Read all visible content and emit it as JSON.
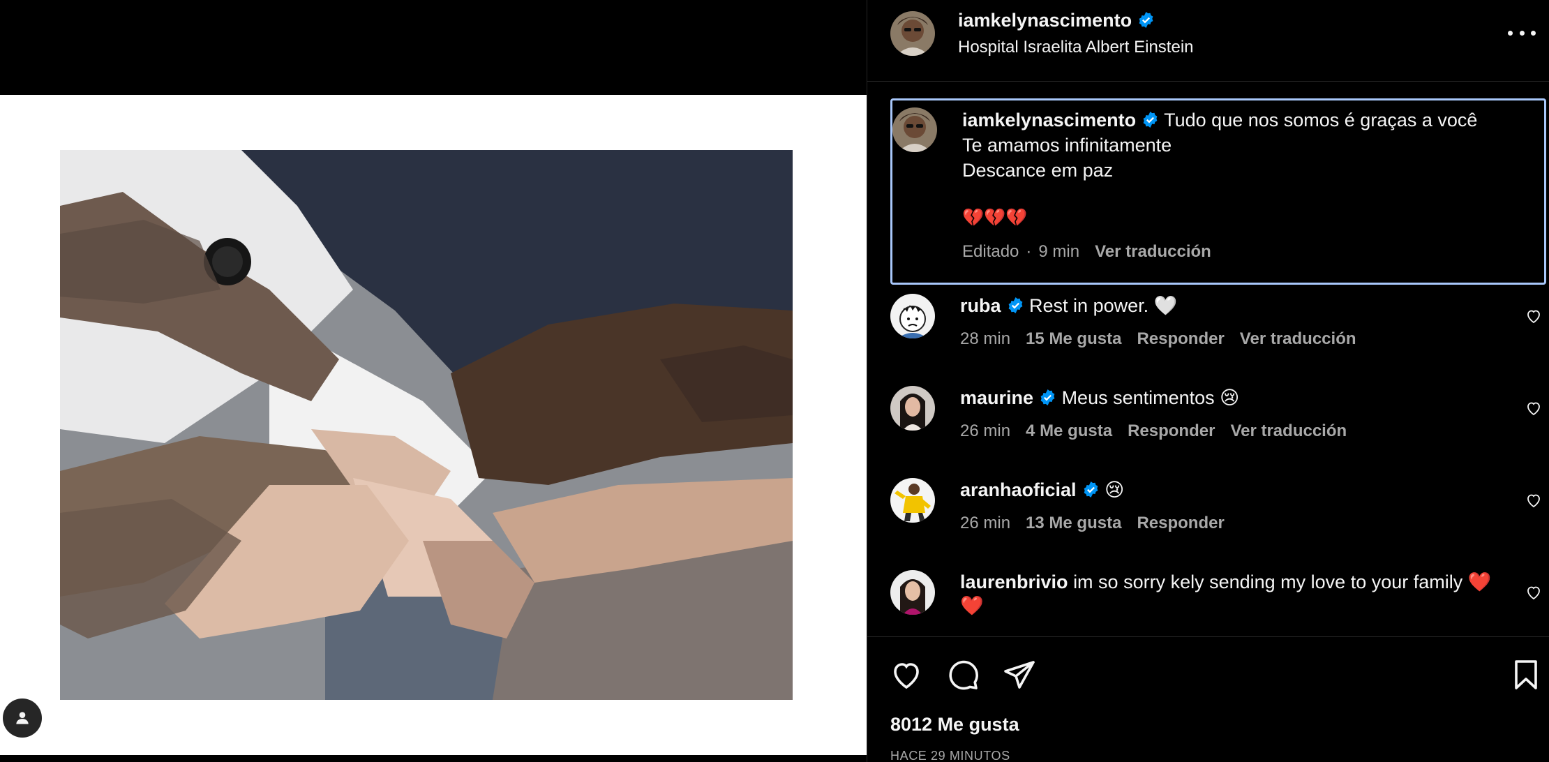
{
  "post": {
    "username": "iamkelynascimento",
    "location": "Hospital Israelita Albert Einstein",
    "verified": true
  },
  "caption": {
    "username": "iamkelynascimento",
    "lines": [
      "Tudo que nos somos é graças a você",
      "Te amamos infinitamente",
      "Descance em paz"
    ],
    "emoji": "💔💔💔",
    "edited": "Editado",
    "time": "9 min",
    "translate": "Ver traducción"
  },
  "comments": [
    {
      "username": "ruba",
      "verified": true,
      "text": "Rest in power. 🤍",
      "time": "28 min",
      "likes": "15 Me gusta",
      "reply": "Responder",
      "translate": "Ver traducción"
    },
    {
      "username": "maurine",
      "verified": true,
      "text": "Meus sentimentos 😢",
      "time": "26 min",
      "likes": "4 Me gusta",
      "reply": "Responder",
      "translate": "Ver traducción"
    },
    {
      "username": "aranhaoficial",
      "verified": true,
      "text": "😢",
      "time": "26 min",
      "likes": "13 Me gusta",
      "reply": "Responder"
    },
    {
      "username": "laurenbrivio",
      "verified": false,
      "text": "im so sorry kely sending my love to your family ❤️❤️"
    }
  ],
  "footer": {
    "likes": "8012 Me gusta",
    "posted": "HACE 29 MINUTOS"
  },
  "colors": {
    "verified": "#0095f6",
    "caption_border": "#a8c7fa",
    "secondary_text": "#a8a8a8"
  }
}
